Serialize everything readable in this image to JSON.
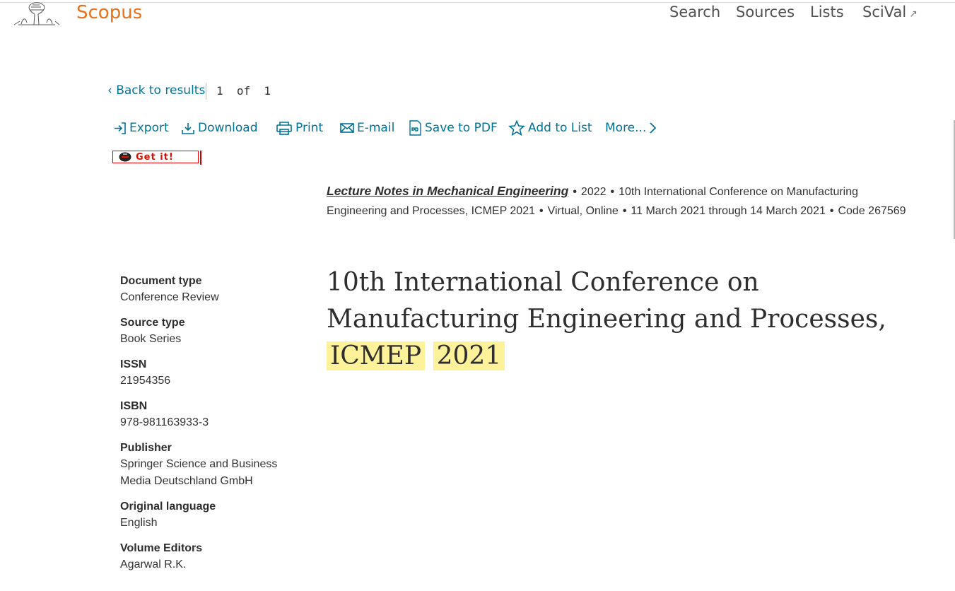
{
  "header": {
    "brand": "Scopus",
    "brand_color": "#e9711c",
    "nav": [
      {
        "label": "Search"
      },
      {
        "label": "Sources"
      },
      {
        "label": "Lists"
      },
      {
        "label": "SciVal"
      }
    ],
    "scival_external_icon": "external-link-icon"
  },
  "results_nav": {
    "back_label": "Back to results",
    "pager": "1  of  1"
  },
  "toolbar": {
    "export": "Export",
    "download": "Download",
    "print": "Print",
    "email": "E-mail",
    "save_pdf": "Save to PDF",
    "add_to_list": "Add to List",
    "more": "More..."
  },
  "getit": {
    "label": "Get it!"
  },
  "meta": {
    "source_title": "Lecture Notes in Mechanical Engineering",
    "year": "2022",
    "conference": "10th International Conference on Manufacturing Engineering and Processes, ICMEP 2021",
    "location": "Virtual, Online",
    "dates": "11 March 2021 through 14 March 2021",
    "code": "Code 267569"
  },
  "title": {
    "main": "10th International Conference on Manufacturing Engineering and Processes,",
    "hl1": "ICMEP",
    "hl2": "2021",
    "highlight_color": "#fdf29a"
  },
  "details": [
    {
      "label": "Document type",
      "value": "Conference Review"
    },
    {
      "label": "Source type",
      "value": "Book Series"
    },
    {
      "label": "ISSN",
      "value": "21954356"
    },
    {
      "label": "ISBN",
      "value": "978-981163933-3"
    },
    {
      "label": "Publisher",
      "value": "Springer Science and Business Media Deutschland GmbH"
    },
    {
      "label": "Original language",
      "value": "English"
    },
    {
      "label": "Volume Editors",
      "value": "Agarwal R.K."
    }
  ],
  "colors": {
    "link": "#007398",
    "text": "#2e2e2e"
  }
}
